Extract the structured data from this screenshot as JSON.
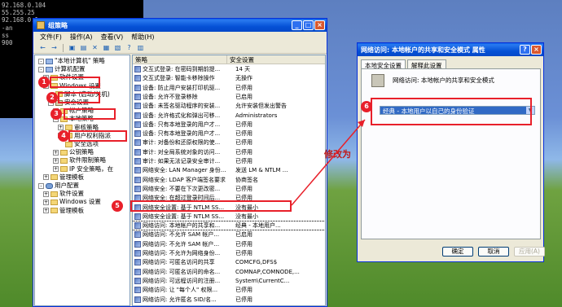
{
  "console": {
    "lines": [
      "92.168.0.104",
      "55.255.25",
      "92.168.0.1",
      "",
      "-an",
      "",
      "",
      "",
      "ss",
      "",
      "",
      "",
      "",
      "",
      "900",
      "",
      "",
      ""
    ]
  },
  "mmc": {
    "title": "组策略",
    "menu": [
      "文件(F)",
      "操作(A)",
      "查看(V)",
      "帮助(H)"
    ],
    "tree": [
      {
        "label": "\"本地计算机\" 策略",
        "icon": "pc"
      },
      {
        "label": "计算机配置",
        "icon": "pc"
      },
      {
        "label": "软件设置",
        "icon": "folder"
      },
      {
        "label": "Windows 设置",
        "icon": "folder"
      },
      {
        "label": "脚本 (启动/关机)",
        "icon": "folder"
      },
      {
        "label": "安全设置",
        "icon": "shield"
      },
      {
        "label": "帐户策略",
        "icon": "folder"
      },
      {
        "label": "本地策略",
        "icon": "folder"
      },
      {
        "label": "审核策略",
        "icon": "folder"
      },
      {
        "label": "用户权利指派",
        "icon": "folder"
      },
      {
        "label": "安全选项",
        "icon": "folder"
      },
      {
        "label": "公钥策略",
        "icon": "folder"
      },
      {
        "label": "软件限制策略",
        "icon": "folder"
      },
      {
        "label": "IP 安全策略，在",
        "icon": "folder"
      },
      {
        "label": "管理模板",
        "icon": "folder"
      },
      {
        "label": "用户配置",
        "icon": "user"
      },
      {
        "label": "软件设置",
        "icon": "folder"
      },
      {
        "label": "Windows 设置",
        "icon": "folder"
      },
      {
        "label": "管理模板",
        "icon": "folder"
      }
    ],
    "list_headers": [
      "策略",
      "安全设置"
    ],
    "list_rows": [
      [
        "交互式登录: 在密码到期前提...",
        "14 天"
      ],
      [
        "交互式登录: 智能卡移除操作",
        "无操作"
      ],
      [
        "设备: 防止用户安装打印机驱...",
        "已停用"
      ],
      [
        "设备: 允许不登录移除",
        "已启用"
      ],
      [
        "设备: 未签名驱动程序的安装...",
        "允许安装但发出警告"
      ],
      [
        "设备: 允许格式化和弹出可移...",
        "Administrators"
      ],
      [
        "设备: 只有本地登录的用户才...",
        "已停用"
      ],
      [
        "设备: 只有本地登录的用户才...",
        "已停用"
      ],
      [
        "审计: 对备份和还原权限的使...",
        "已停用"
      ],
      [
        "审计: 对全局系统对象的访问...",
        "已停用"
      ],
      [
        "审计: 如果无法记录安全审计...",
        "已停用"
      ],
      [
        "网络安全: LAN Manager 身份...",
        "发送 LM & NTLM ..."
      ],
      [
        "网络安全: LDAP 客户端签名要求",
        "协商签名"
      ],
      [
        "网络安全: 不要在下次更改密...",
        "已停用"
      ],
      [
        "网络安全: 在超过登录时间后...",
        "已停用"
      ],
      [
        "网络安全设置: 基于 NTLM SS...",
        "没有最小"
      ],
      [
        "网络安全设置: 基于 NTLM SS...",
        "没有最小"
      ],
      [
        "网络访问: 本地帐户的共享和...",
        "经典 - 本地用户..."
      ],
      [
        "网络访问: 不允许 SAM 帐户...",
        "已启用"
      ],
      [
        "网络访问: 不允许 SAM 帐户...",
        "已停用"
      ],
      [
        "网络访问: 不允许为网络身份...",
        "已停用"
      ],
      [
        "网络访问: 可匿名访问的共享",
        "COMCFG,DFS$"
      ],
      [
        "网络访问: 可匿名访问的命名...",
        "COMNAP,COMNODE,..."
      ],
      [
        "网络访问: 可远程访问的注册...",
        "System\\CurrentC..."
      ],
      [
        "网络访问: 让 \"每个人\" 权限...",
        "已停用"
      ],
      [
        "网络访问: 允许匿名 SID/名...",
        "已停用"
      ]
    ]
  },
  "dialog": {
    "title": "网络访问: 本地帐户的共享和安全模式 属性",
    "tabs": [
      "本地安全设置",
      "解释此设置"
    ],
    "description": "网络访问: 本地帐户的共享和安全模式",
    "selected_value": "经典 - 本地用户以自己的身份验证",
    "buttons": {
      "ok": "确定",
      "cancel": "取消",
      "apply": "应用(A)"
    }
  },
  "annotations": {
    "badges": [
      "1",
      "2",
      "3",
      "4",
      "5",
      "6"
    ],
    "note": "修改为"
  },
  "colors": {
    "accent": "#0a5ee8",
    "annotation": "#e8202a",
    "selection": "#316ac5"
  }
}
